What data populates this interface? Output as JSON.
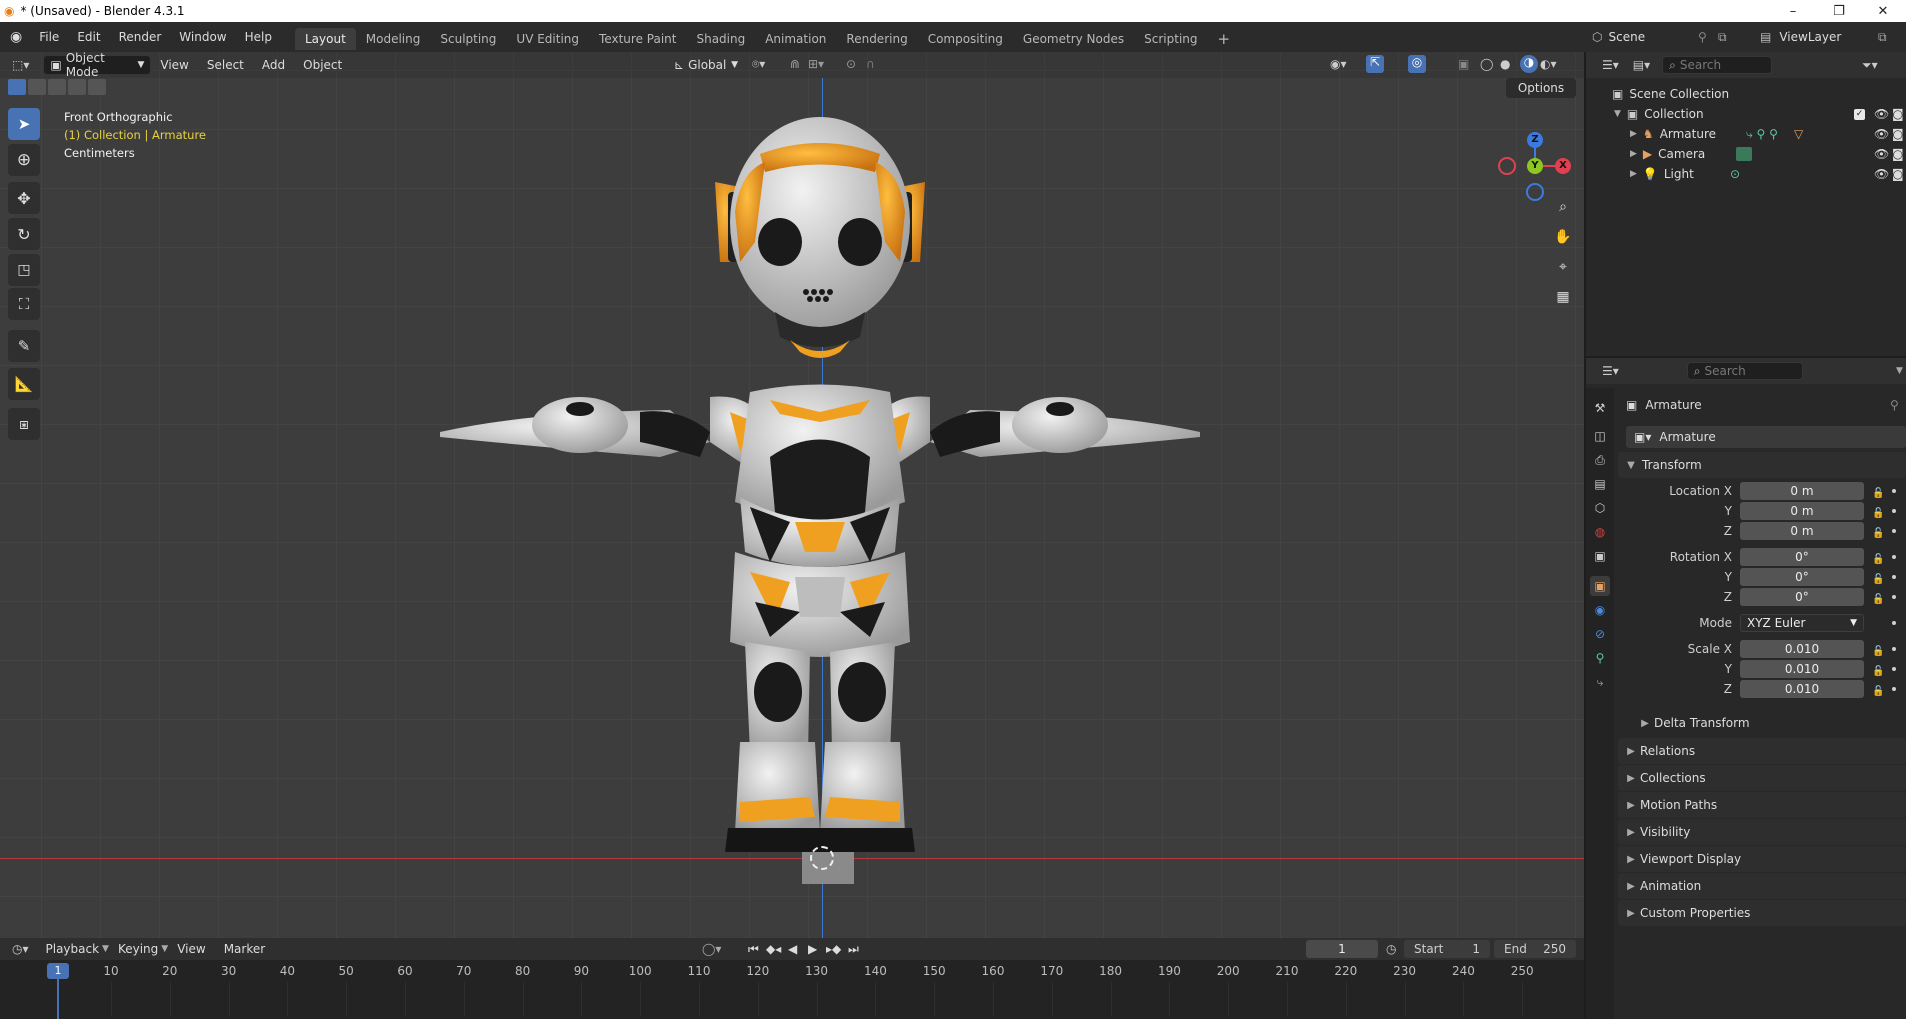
{
  "window": {
    "title": "* (Unsaved) - Blender 4.3.1",
    "controls": [
      "–",
      "❐",
      "✕"
    ]
  },
  "topbar": {
    "menus": [
      "File",
      "Edit",
      "Render",
      "Window",
      "Help"
    ],
    "workspaces": [
      "Layout",
      "Modeling",
      "Sculpting",
      "UV Editing",
      "Texture Paint",
      "Shading",
      "Animation",
      "Rendering",
      "Compositing",
      "Geometry Nodes",
      "Scripting"
    ],
    "active_workspace": "Layout",
    "add_tab": "+",
    "scene": "Scene",
    "view_layer": "ViewLayer"
  },
  "viewport": {
    "mode": "Object Mode",
    "menus": [
      "View",
      "Select",
      "Add",
      "Object"
    ],
    "orientation": "Global",
    "options_label": "Options",
    "overlay": {
      "view_name": "Front Orthographic",
      "collection_info": "(1) Collection | Armature",
      "units": "Centimeters"
    },
    "gizmo_axes": [
      "Z",
      "Y",
      "X"
    ]
  },
  "outliner": {
    "search_placeholder": "Search",
    "root": "Scene Collection",
    "collection": "Collection",
    "items": [
      {
        "name": "Armature"
      },
      {
        "name": "Camera"
      },
      {
        "name": "Light"
      }
    ]
  },
  "properties": {
    "search_placeholder": "Search",
    "object_name": "Armature",
    "object_datablock": "Armature",
    "transform_title": "Transform",
    "location": {
      "label_x": "Location X",
      "x": "0 m",
      "y": "0 m",
      "z": "0 m"
    },
    "rotation": {
      "label_x": "Rotation X",
      "x": "0°",
      "y": "0°",
      "z": "0°"
    },
    "mode_label": "Mode",
    "mode_value": "XYZ Euler",
    "scale": {
      "label_x": "Scale X",
      "x": "0.010",
      "y": "0.010",
      "z": "0.010"
    },
    "axis_y": "Y",
    "axis_z": "Z",
    "delta_transform": "Delta Transform",
    "sections": [
      "Relations",
      "Collections",
      "Motion Paths",
      "Visibility",
      "Viewport Display",
      "Animation",
      "Custom Properties"
    ]
  },
  "timeline": {
    "menus": [
      "Playback",
      "Keying",
      "View",
      "Marker"
    ],
    "current_frame": "1",
    "start_label": "Start",
    "start_value": "1",
    "end_label": "End",
    "end_value": "250",
    "ruler_ticks": [
      "1",
      "10",
      "20",
      "30",
      "40",
      "50",
      "60",
      "70",
      "80",
      "90",
      "100",
      "110",
      "120",
      "130",
      "140",
      "150",
      "160",
      "170",
      "180",
      "190",
      "200",
      "210",
      "220",
      "230",
      "240",
      "250"
    ]
  },
  "colors": {
    "accent_blue": "#4772b3",
    "robot_orange": "#f0a020",
    "axis_x": "#e04050",
    "axis_y": "#8cc820",
    "axis_z": "#3c7ae0",
    "collection_info_yellow": "#e8d240"
  }
}
